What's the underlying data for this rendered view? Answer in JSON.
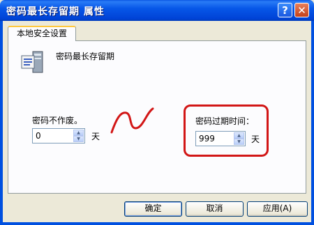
{
  "window": {
    "title": "密码最长存留期 属性",
    "help_label": "?",
    "close_label": "✕"
  },
  "tab": {
    "label": "本地安全设置"
  },
  "policy": {
    "name": "密码最长存留期",
    "icon": "policy-server-icon"
  },
  "never_expire": {
    "label": "密码不作废。",
    "value": "0",
    "unit": "天"
  },
  "expire_after": {
    "label": "密码过期时间：",
    "value": "999",
    "unit": "天"
  },
  "buttons": {
    "ok": "确定",
    "cancel": "取消",
    "apply": "应用(A)"
  },
  "colors": {
    "annotation": "#d21616",
    "titlebar": "#0757e8"
  }
}
